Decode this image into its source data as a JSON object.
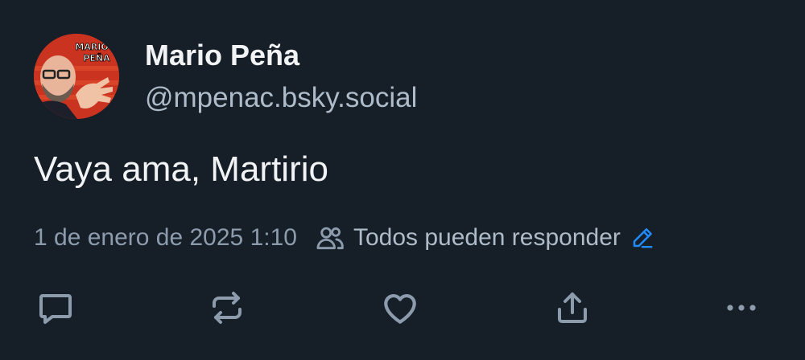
{
  "post": {
    "author": {
      "display_name": "Mario Peña",
      "handle": "@mpenac.bsky.social",
      "avatar_text_line1": "MARIO",
      "avatar_text_line2": "PEÑA"
    },
    "text": "Vaya ama, Martirio",
    "timestamp": "1 de enero de 2025 1:10",
    "reply_setting": "Todos pueden responder"
  },
  "icons": {
    "people": "people-icon",
    "edit": "pencil-icon",
    "reply": "speech-bubble-icon",
    "repost": "repost-icon",
    "like": "heart-icon",
    "share": "share-icon",
    "more": "more-dots-icon"
  },
  "colors": {
    "background": "#161e27",
    "text_primary": "#f1f3f5",
    "text_secondary": "#aebbc9",
    "icon": "#8d9cad",
    "accent": "#208bfe"
  }
}
